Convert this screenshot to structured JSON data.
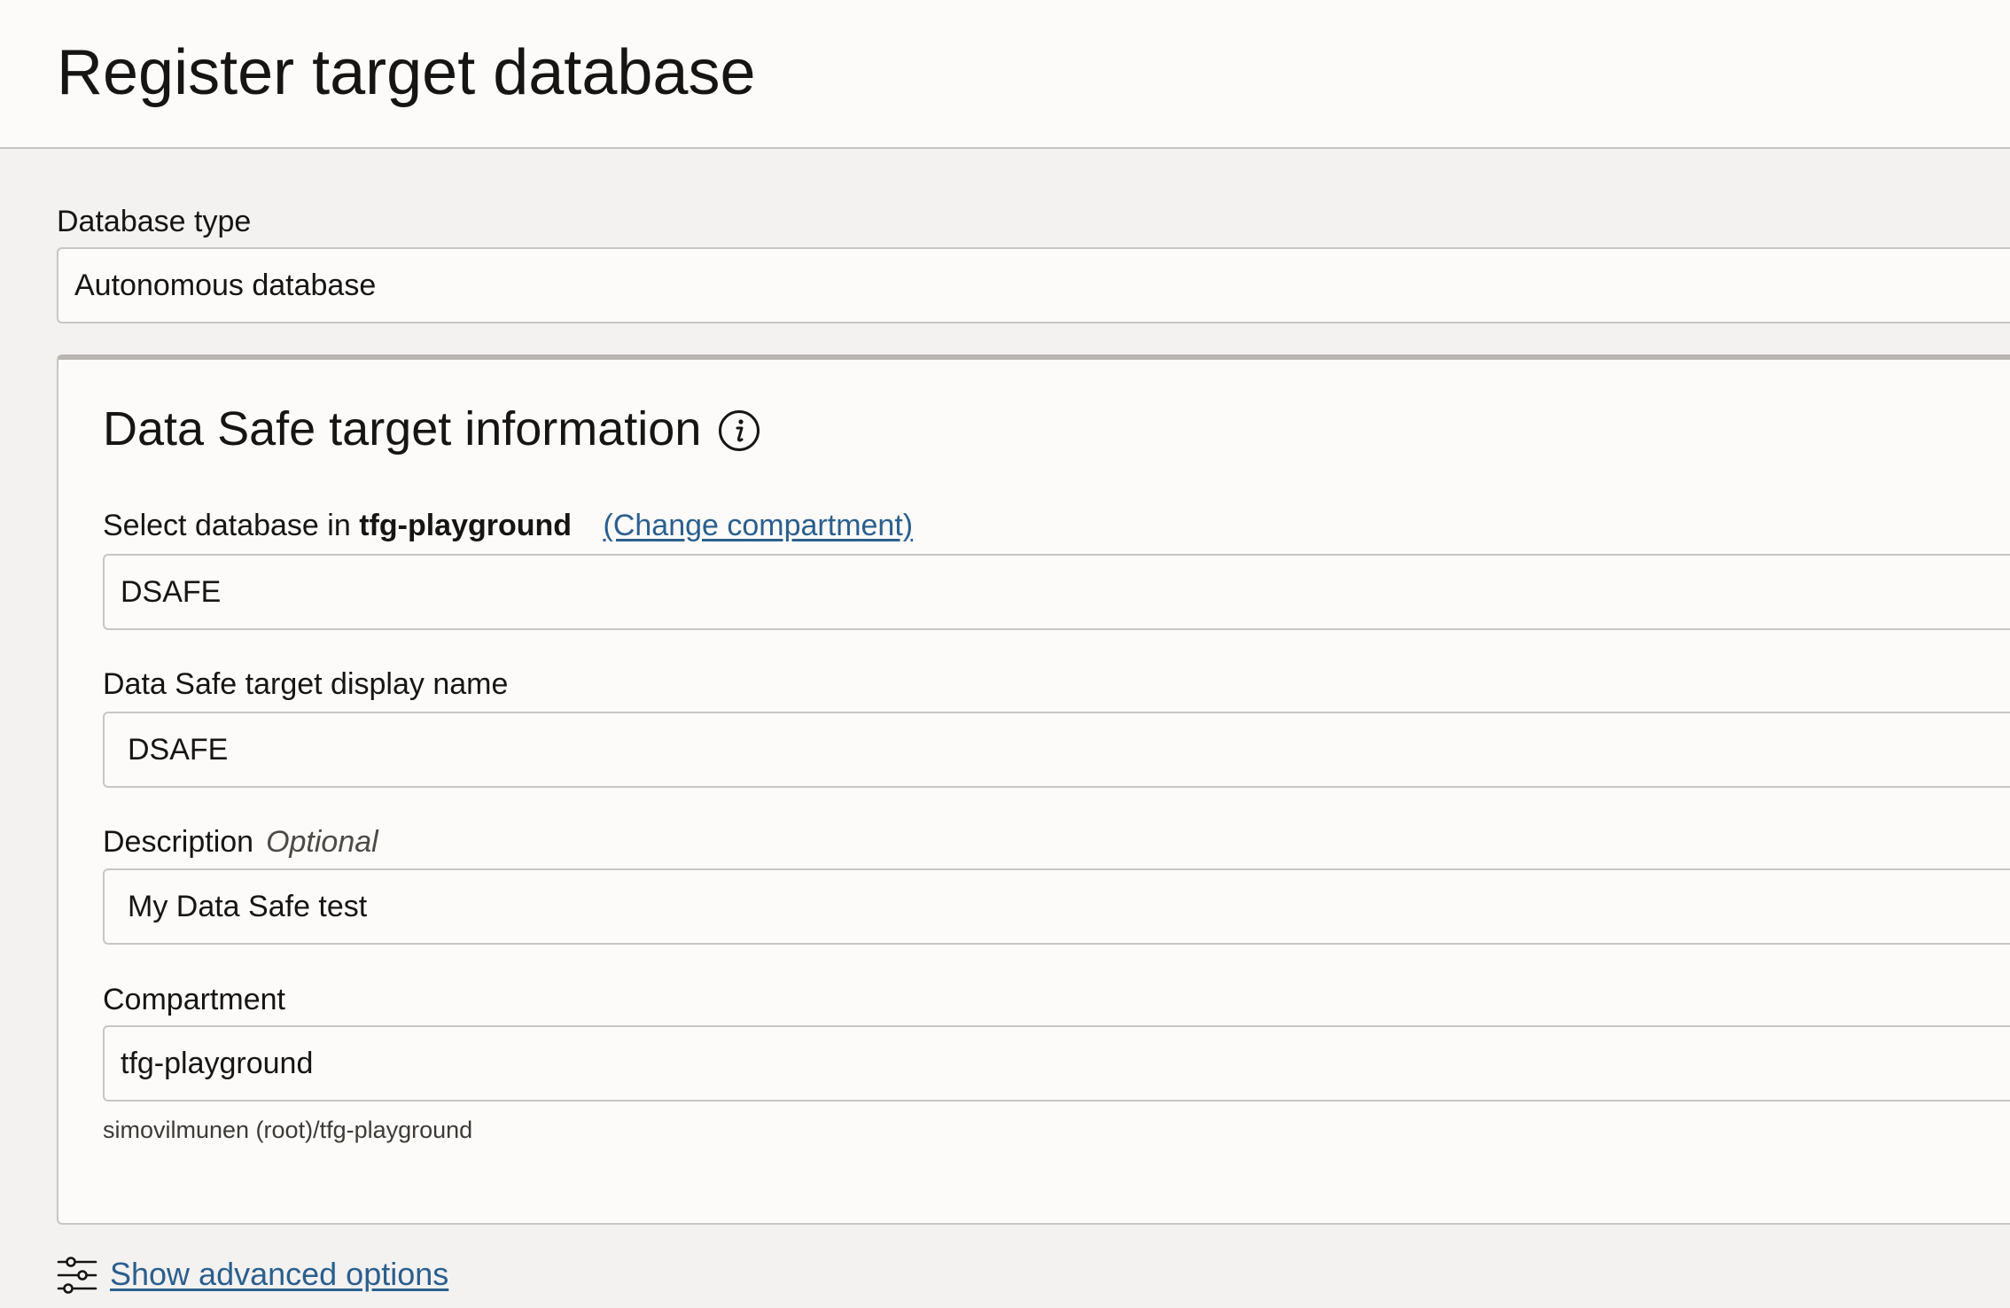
{
  "page": {
    "title": "Register target database"
  },
  "database_type": {
    "label": "Database type",
    "value": "Autonomous database"
  },
  "target_info": {
    "heading": "Data Safe target information",
    "info_icon": "info-circle-icon",
    "select_database": {
      "label_prefix": "Select database in",
      "compartment_name": "tfg-playground",
      "change_link": "(Change compartment)",
      "value": "DSAFE"
    },
    "display_name": {
      "label": "Data Safe target display name",
      "value": "DSAFE"
    },
    "description": {
      "label": "Description",
      "optional_label": "Optional",
      "value": "My Data Safe test"
    },
    "compartment": {
      "label": "Compartment",
      "value": "tfg-playground",
      "path": "simovilmunen (root)/tfg-playground"
    }
  },
  "advanced": {
    "icon": "sliders-icon",
    "link_label": "Show advanced options"
  },
  "colors": {
    "link": "#2b5f8d",
    "background": "#f3f2f1",
    "surface": "#fcfbfa",
    "border": "#c9c6c2"
  }
}
